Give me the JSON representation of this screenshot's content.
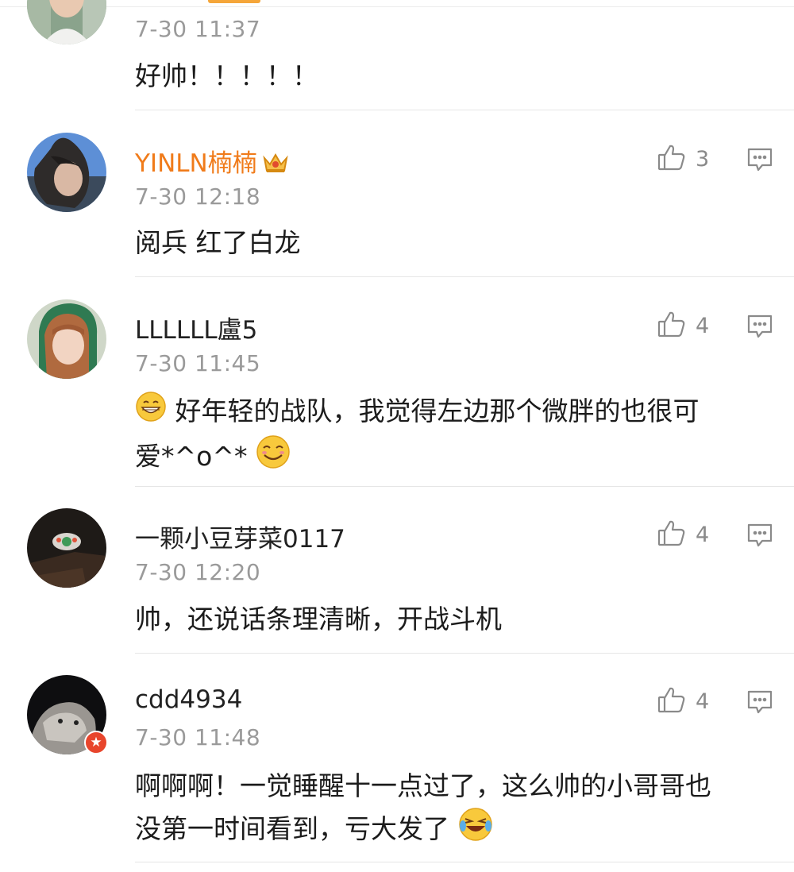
{
  "comments": [
    {
      "username": "",
      "time": "7-30 11:37",
      "text": "好帅！！！！！",
      "likes": "",
      "avatar": "avatar-girl-outdoor"
    },
    {
      "username": "YINLN楠楠",
      "vip": true,
      "time": "7-30 12:18",
      "text": "阅兵 红了白龙",
      "likes": "3",
      "avatar": "avatar-girl-sky"
    },
    {
      "username": "LLLLLL盧5",
      "time": "7-30 11:45",
      "text_line1": "好年轻的战队，我觉得左边那个微胖的也很可",
      "text_line2": "爱*^o^*",
      "likes": "4",
      "avatar": "avatar-girl-hood"
    },
    {
      "username": "一颗小豆芽菜0117",
      "time": "7-30 12:20",
      "text": "帅，还说话条理清晰，开战斗机",
      "likes": "4",
      "avatar": "avatar-dark-object"
    },
    {
      "username": "cdd4934",
      "time": "7-30 11:48",
      "text_line1": "啊啊啊！一觉睡醒十一点过了，这么帅的小哥哥也",
      "text_line2": "没第一时间看到，亏大发了",
      "likes": "4",
      "avatar": "avatar-cat",
      "badge": "★"
    }
  ],
  "icons": {
    "like": "thumbs-up-icon",
    "reply": "comment-icon"
  },
  "colors": {
    "vip_name": "#f07b1a",
    "time": "#9a9a9a",
    "badge": "#e8452c"
  }
}
